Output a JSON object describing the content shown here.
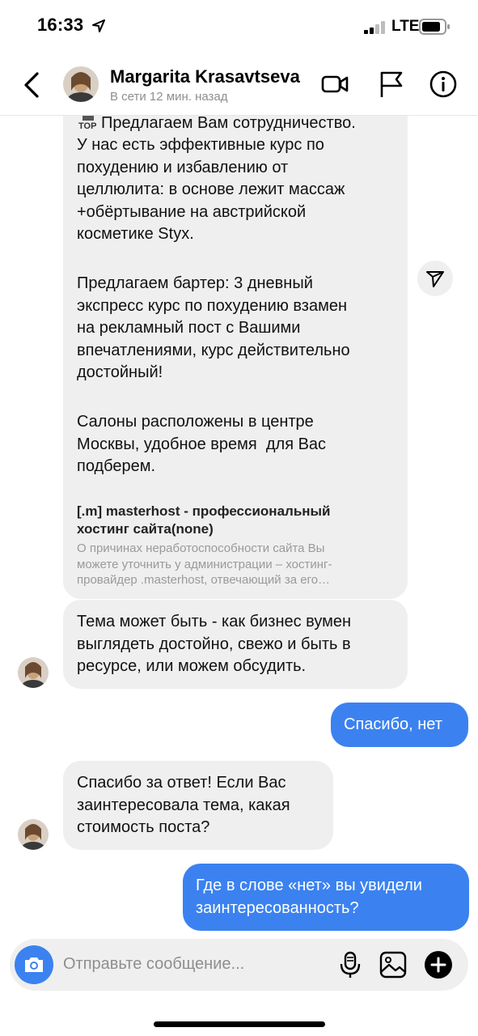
{
  "status_bar": {
    "time": "16:33",
    "network": "LTE"
  },
  "header": {
    "name": "Margarita Krasavtseva",
    "presence": "В сети 12 мин. назад"
  },
  "messages": {
    "first": {
      "paragraph1": "Предлагаем Вам сотрудничество.\nУ нас есть эффективные курс по\nпохудению и избавлению от\nцеллюлита: в основе лежит массаж\n+обёртывание на австрийской\nкосметике Styx.",
      "paragraph2": "Предлагаем бартер: 3 дневный\nэкспресс курс по похудению взамен\nна рекламный пост с Вашими\nвпечатлениями, курс действительно\nдостойный!",
      "paragraph3": "Салоны расположены в центре\nМосквы, удобное время  для Вас\nподберем.",
      "top_badge": "TOP",
      "link_title": "[.m] masterhost - профессиональный\nхостинг сайта(none)",
      "link_desc": "О причинах неработоспособности сайта Вы\nможете уточнить у администрации – хостинг-\nпровайдер .masterhost, отвечающий за его…"
    },
    "second": "Тема может быть - как бизнес вумен\nвыглядеть достойно, свежо и быть в\nресурсе, или можем обсудить.",
    "reply1": "Спасибо, нет",
    "third": "Спасибо за ответ! Если Вас\nзаинтересовала тема, какая\nстоимость поста?",
    "reply2": "Где в слове «нет» вы увидели\nзаинтересованность?"
  },
  "composer": {
    "placeholder": "Отправьте сообщение..."
  },
  "icons": {
    "back": "chevron-left-icon",
    "video": "video-camera-icon",
    "flag": "flag-icon",
    "info": "info-icon",
    "share": "paper-plane-icon",
    "camera": "camera-icon",
    "mic": "microphone-icon",
    "gallery": "image-icon",
    "add": "plus-circle-icon"
  },
  "colors": {
    "accent": "#3b82f0",
    "bubble_in": "#efefef",
    "muted": "#8e8e8e"
  }
}
